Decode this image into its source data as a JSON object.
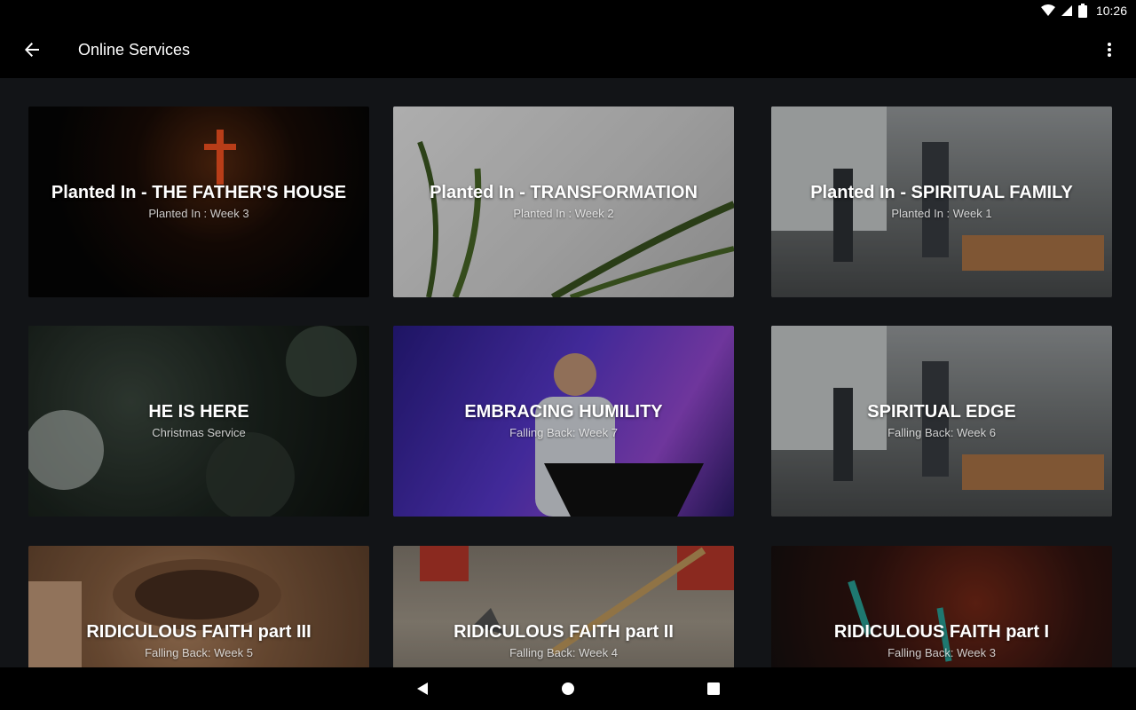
{
  "status_bar": {
    "time": "10:26"
  },
  "app_bar": {
    "title": "Online Services"
  },
  "cards": [
    {
      "title": "Planted In - THE FATHER'S HOUSE",
      "subtitle": "Planted In : Week 3"
    },
    {
      "title": "Planted In - TRANSFORMATION",
      "subtitle": "Planted In : Week 2"
    },
    {
      "title": "Planted In - SPIRITUAL FAMILY",
      "subtitle": "Planted In : Week 1"
    },
    {
      "title": "HE IS HERE",
      "subtitle": "Christmas Service"
    },
    {
      "title": "EMBRACING HUMILITY",
      "subtitle": "Falling Back: Week 7"
    },
    {
      "title": "SPIRITUAL EDGE",
      "subtitle": "Falling Back: Week 6"
    },
    {
      "title": "RIDICULOUS FAITH part III",
      "subtitle": "Falling Back: Week 5"
    },
    {
      "title": "RIDICULOUS FAITH part II",
      "subtitle": "Falling Back: Week 4"
    },
    {
      "title": "RIDICULOUS FAITH part I",
      "subtitle": "Falling Back: Week 3"
    }
  ]
}
